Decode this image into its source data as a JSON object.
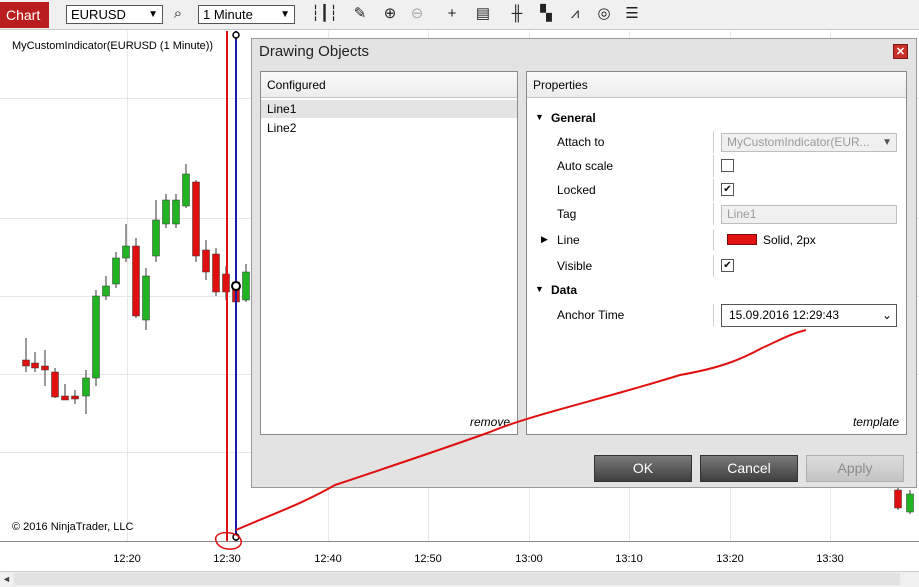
{
  "toolbar": {
    "tab_label": "Chart",
    "instrument": "EURUSD",
    "interval": "1 Minute",
    "icons": [
      "search-icon",
      "bar-style-icon",
      "pencil-icon",
      "zoom-in-icon",
      "zoom-out-icon",
      "crosshair-icon",
      "data-box-icon",
      "bars-icon",
      "strategy-icon",
      "indicator-icon",
      "refresh-icon",
      "properties-icon"
    ]
  },
  "chart": {
    "indicator_label": "MyCustomIndicator(EURUSD (1 Minute))",
    "copyright": "© 2016 NinjaTrader, LLC",
    "x_labels": [
      "12:20",
      "12:30",
      "12:40",
      "12:50",
      "13:00",
      "13:10",
      "13:20",
      "13:30"
    ],
    "colors": {
      "up": "#22b322",
      "down": "#e01010",
      "line1": "#e01010",
      "line2": "#1a1aa8",
      "annotation": "#e01010"
    }
  },
  "dialog": {
    "title": "Drawing Objects",
    "configured": {
      "header": "Configured",
      "items": [
        "Line1",
        "Line2"
      ],
      "remove_label": "remove"
    },
    "properties": {
      "header": "Properties",
      "general_label": "General",
      "attach_to_label": "Attach to",
      "attach_to_value": "MyCustomIndicator(EUR...",
      "auto_scale_label": "Auto scale",
      "auto_scale_checked": false,
      "locked_label": "Locked",
      "locked_checked": true,
      "tag_label": "Tag",
      "tag_value": "Line1",
      "line_label": "Line",
      "line_value": "Solid, 2px",
      "line_color": "#e31212",
      "visible_label": "Visible",
      "visible_checked": true,
      "data_label": "Data",
      "anchor_time_label": "Anchor Time",
      "anchor_time_value": "15.09.2016 12:29:43",
      "template_label": "template"
    },
    "buttons": {
      "ok": "OK",
      "cancel": "Cancel",
      "apply": "Apply"
    }
  }
}
